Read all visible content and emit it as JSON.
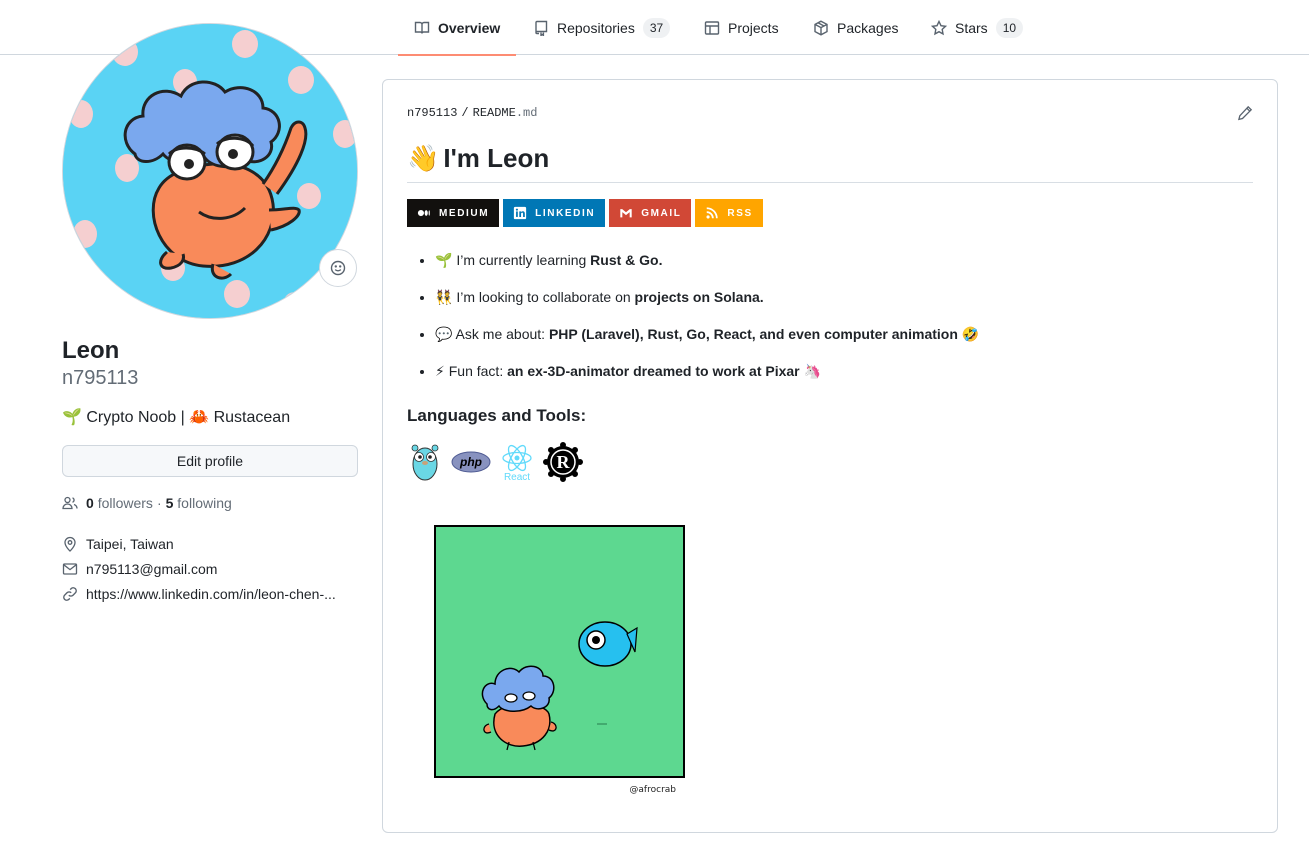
{
  "nav": {
    "tabs": [
      {
        "label": "Overview",
        "icon": "book-icon",
        "active": true
      },
      {
        "label": "Repositories",
        "icon": "repo-icon",
        "count": "37"
      },
      {
        "label": "Projects",
        "icon": "table-icon"
      },
      {
        "label": "Packages",
        "icon": "package-icon"
      },
      {
        "label": "Stars",
        "icon": "star-icon",
        "count": "10"
      }
    ]
  },
  "profile": {
    "name": "Leon",
    "login": "n795113",
    "bio": "🌱 Crypto Noob | 🦀 Rustacean",
    "edit_label": "Edit profile",
    "followers_count": "0",
    "followers_label": "followers",
    "separator": "·",
    "following_count": "5",
    "following_label": "following",
    "location": "Taipei, Taiwan",
    "email": "n795113@gmail.com",
    "website": "https://www.linkedin.com/in/leon-chen-..."
  },
  "readme": {
    "owner": "n795113",
    "separator": "/",
    "file_name": "README",
    "file_ext": ".md",
    "title_emoji": "👋",
    "title": "I'm Leon",
    "badges": [
      {
        "label": "MEDIUM",
        "color": "#12100e",
        "icon": "medium-icon"
      },
      {
        "label": "LINKEDIN",
        "color": "#0077b5",
        "icon": "linkedin-icon"
      },
      {
        "label": "GMAIL",
        "color": "#d14836",
        "icon": "gmail-icon"
      },
      {
        "label": "RSS",
        "color": "#ffa500",
        "icon": "rss-icon"
      }
    ],
    "bullets": [
      {
        "emoji": "🌱",
        "text": " I’m currently learning ",
        "bold": "Rust & Go.",
        "tail": ""
      },
      {
        "emoji": "👯",
        "text": " I’m looking to collaborate on ",
        "bold": "projects on Solana.",
        "tail": ""
      },
      {
        "emoji": "💬",
        "text": " Ask me about: ",
        "bold": "PHP (Laravel), Rust, Go, React, and even computer animation",
        "tail": " 🤣"
      },
      {
        "emoji": "⚡",
        "text": " Fun fact: ",
        "bold": "an ex-3D-animator dreamed to work at Pixar",
        "tail": " 🦄"
      }
    ],
    "tools_heading": "Languages and Tools:",
    "tools": [
      {
        "icon": "golang-gopher-icon"
      },
      {
        "icon": "php-icon",
        "label": "php"
      },
      {
        "icon": "react-icon",
        "label": "React"
      },
      {
        "icon": "rust-icon",
        "label": "R"
      }
    ],
    "comic_signature": "@afrocrab"
  }
}
